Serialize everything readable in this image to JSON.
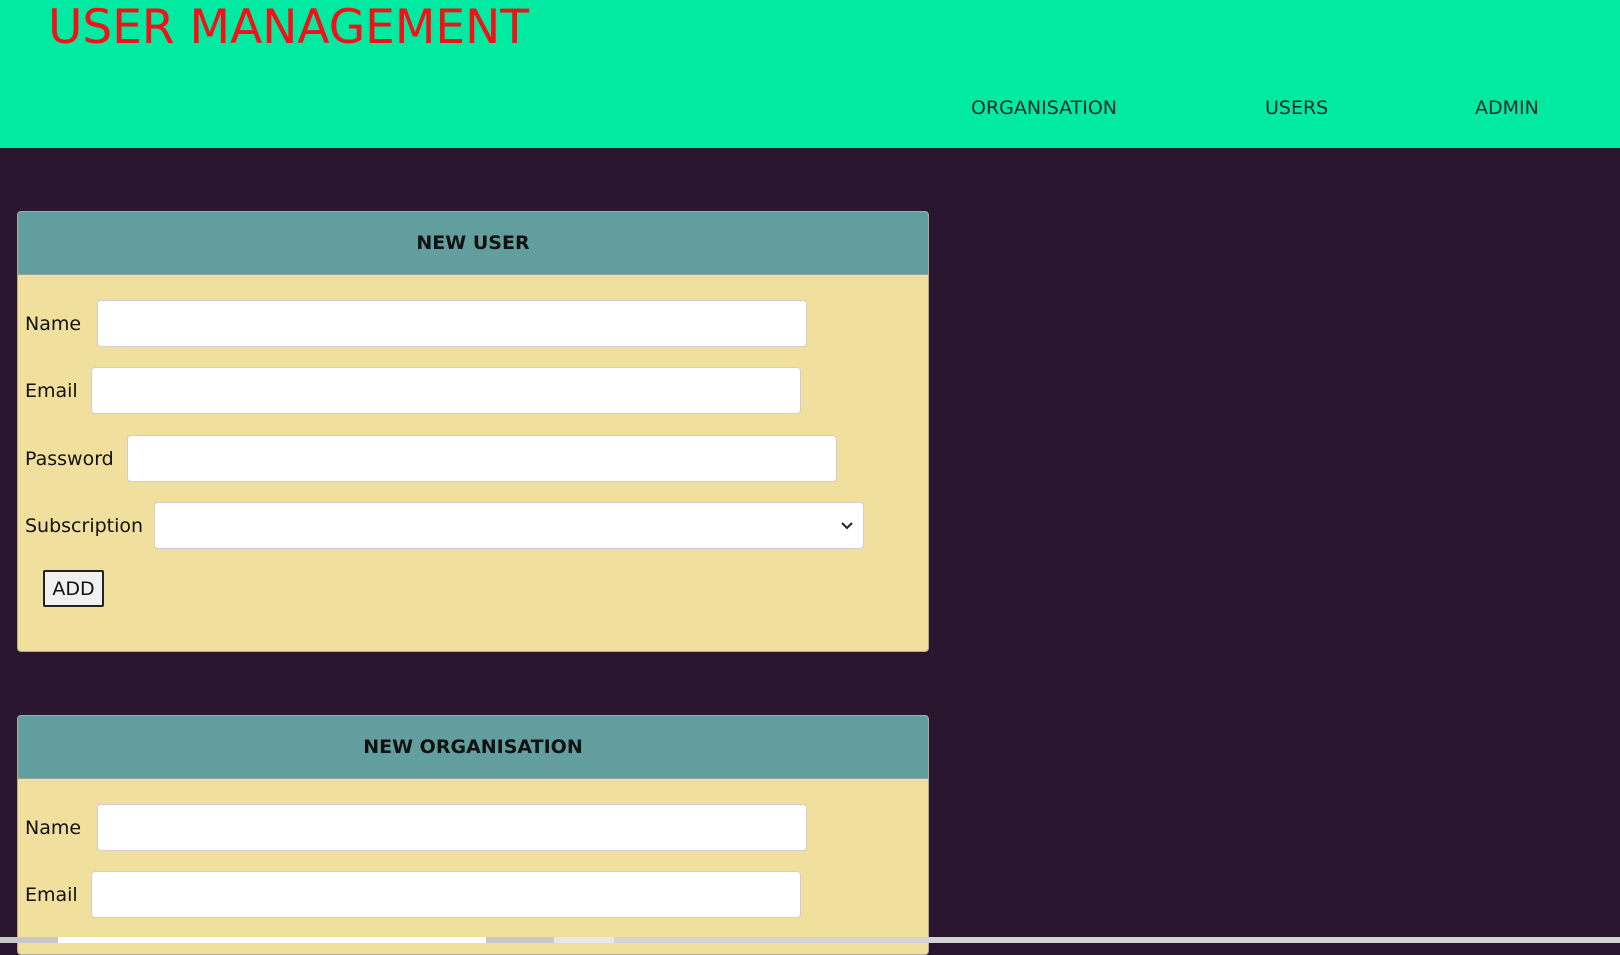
{
  "header": {
    "title": "USER MANAGEMENT",
    "nav": [
      {
        "label": "ORGANISATION"
      },
      {
        "label": "USERS"
      },
      {
        "label": "ADMIN"
      }
    ]
  },
  "new_user": {
    "title": "NEW USER",
    "fields": [
      {
        "label": "Name",
        "value": ""
      },
      {
        "label": "Email",
        "value": ""
      },
      {
        "label": "Password",
        "value": ""
      },
      {
        "label": "Subscription",
        "value": ""
      }
    ],
    "add_label": "ADD"
  },
  "new_org": {
    "title": "NEW ORGANISATION",
    "fields": [
      {
        "label": "Name",
        "value": ""
      },
      {
        "label": "Email",
        "value": ""
      }
    ]
  },
  "colors": {
    "header_bg": "#00eaa2",
    "title": "#f50f16",
    "page_bg": "#2a162e",
    "panel_bg": "#f0df9d",
    "panel_header_bg": "#639e9f"
  },
  "icons": {
    "select_arrow": "chevron-down-icon"
  }
}
